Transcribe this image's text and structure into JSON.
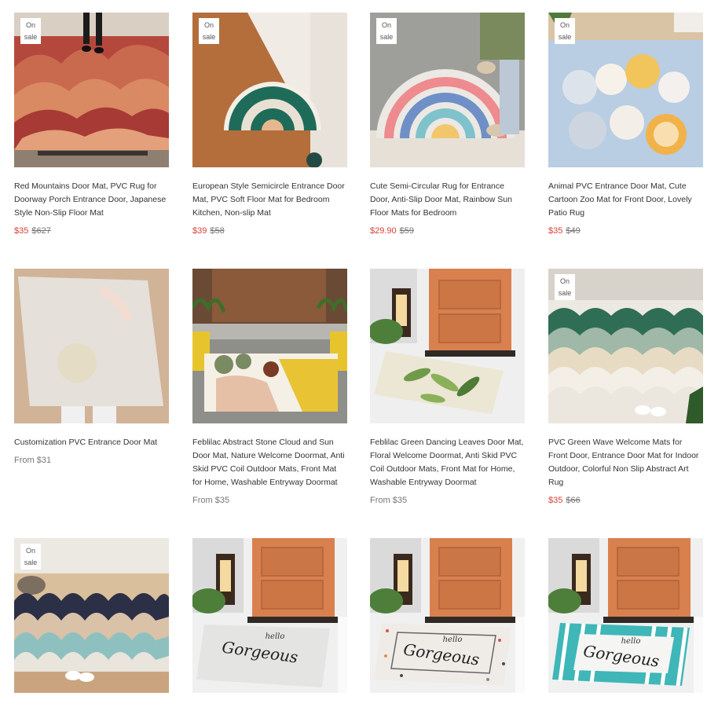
{
  "badge_label": "On sale",
  "products": [
    {
      "title": "Red Mountains Door Mat, PVC Rug for Doorway Porch Entrance Door, Japanese Style Non-Slip Floor Mat",
      "sale": "$35",
      "was": "$627",
      "from": "",
      "on_sale": true
    },
    {
      "title": "European Style Semicircle Entrance Door Mat, PVC Soft Floor Mat for Bedroom Kitchen, Non-slip Mat",
      "sale": "$39",
      "was": "$58",
      "from": "",
      "on_sale": true
    },
    {
      "title": "Cute Semi-Circular Rug for Entrance Door, Anti-Slip Door Mat, Rainbow Sun Floor Mats for Bedroom",
      "sale": "$29.90",
      "was": "$59",
      "from": "",
      "on_sale": true
    },
    {
      "title": "Animal PVC Entrance Door Mat, Cute Cartoon Zoo Mat for Front Door, Lovely Patio Rug",
      "sale": "$35",
      "was": "$49",
      "from": "",
      "on_sale": true
    },
    {
      "title": "Customization PVC Entrance Door Mat",
      "sale": "",
      "was": "",
      "from": "From $31",
      "on_sale": false
    },
    {
      "title": "Feblilac Abstract Stone Cloud and Sun Door Mat, Nature Welcome Doormat, Anti Skid PVC Coil Outdoor Mats, Front Mat for Home, Washable Entryway Doormat",
      "sale": "",
      "was": "",
      "from": "From $35",
      "on_sale": false
    },
    {
      "title": "Feblilac Green Dancing Leaves Door Mat, Floral Welcome Doormat, Anti Skid PVC Coil Outdoor Mats, Front Mat for Home, Washable Entryway Doormat",
      "sale": "",
      "was": "",
      "from": "From $35",
      "on_sale": false
    },
    {
      "title": "PVC Green Wave Welcome Mats for Front Door, Entrance Door Mat for Indoor Outdoor, Colorful Non Slip Abstract Art Rug",
      "sale": "$35",
      "was": "$66",
      "from": "",
      "on_sale": true
    },
    {
      "title": "",
      "sale": "",
      "was": "",
      "from": "",
      "on_sale": true
    },
    {
      "title": "",
      "sale": "",
      "was": "",
      "from": "",
      "on_sale": false
    },
    {
      "title": "",
      "sale": "",
      "was": "",
      "from": "",
      "on_sale": false
    },
    {
      "title": "",
      "sale": "",
      "was": "",
      "from": "",
      "on_sale": false
    }
  ],
  "mat_texts": {
    "small": "hello",
    "large": "Gorgeous"
  },
  "colors": {
    "sale_price": "#d8403a",
    "strike_price": "#777777",
    "title": "#333333"
  }
}
